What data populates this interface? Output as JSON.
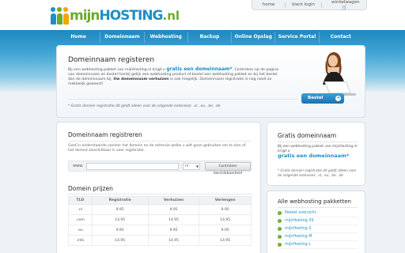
{
  "logo": {
    "mijn": "mijn",
    "hosting": "HOSTING",
    "tld": ".nl"
  },
  "toplinks": {
    "home": "home",
    "login": "klant login",
    "cart": "winkelwagen"
  },
  "nav": [
    "Home",
    "Domeinnaam",
    "Webhosting",
    "Backup",
    "Online Opslag",
    "Service Portal",
    "Contact"
  ],
  "hero": {
    "title": "Domeinnaam registeren",
    "text_1": "Bij een webhosting pakket van mijnHosting.nl krijgt u ",
    "text_highlight": "gratis een domeinnaam*",
    "text_2": ". Controleer op de pagina van domeinnaam en bestel hierbij gelijk een webhosting product of bestel een webhosting pakket en bij het bestel dan de domeinnaam bij. ",
    "text_bold": "Uw domeinnaam verhuizen",
    "text_3": " is ook mogelijk. Domeinnaam registratie is nog nooit zo makkelijk geweest!",
    "note": "* Gratis domein registratie dit geldt alleen voor de volgende extensies: .nl, .eu, .be, .de",
    "button": "Bestel",
    "button_arrow": "➜"
  },
  "main": {
    "title": "Domeinnaam registreren",
    "text": "Geef in onderstaande venster het domein en de extensie welke u wilt gaan gebruiken om te zien of het domein beschikbaar is voor registratie.",
    "www": "www.",
    "input_value": "",
    "select_value": "nl",
    "check_button": "Controleer beschikbaarheid",
    "prices_title": "Domein prijzen",
    "table": {
      "headers": [
        "TLD",
        "Registratie",
        "Verhuizen",
        "Verlengen"
      ],
      "rows": [
        [
          ".nl",
          "9.95",
          "9.95",
          "9.95"
        ],
        [
          ".com",
          "14.95",
          "14.95",
          "14.95"
        ],
        [
          ".eu",
          "9.95",
          "9.95",
          "9.95"
        ],
        [
          ".info",
          "14.95",
          "14.95",
          "14.95"
        ]
      ]
    }
  },
  "sidebar_free": {
    "title": "Gratis domeinnaam",
    "text": "Bij een webhosting pakket van mijnHosting.nl krijgt u",
    "highlight": "gratis een domeinnaam*",
    "note": "* Gratis domein registratie dit geldt alleen voor de volgende extensies: .nl, .eu, .be, .de"
  },
  "sidebar_packages": {
    "title": "Alle webhosting pakketten",
    "items": [
      "Pakket overzicht",
      "mijnHosting XS",
      "mijnHosting S",
      "mijnHosting M",
      "mijnHosting L"
    ]
  },
  "colors": {
    "brand_blue": "#1e8fc6",
    "brand_green": "#6aab2a"
  }
}
